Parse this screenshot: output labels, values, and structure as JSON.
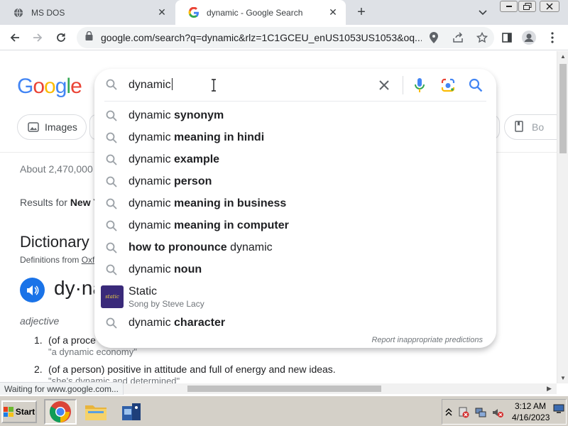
{
  "tabs": [
    {
      "title": "MS DOS",
      "active": false
    },
    {
      "title": "dynamic - Google Search",
      "active": true
    }
  ],
  "window_controls": {
    "minimize": "minimize",
    "restore": "restore",
    "close": "close"
  },
  "omnibox": {
    "url": "google.com/search?q=dynamic&rlz=1C1GCEU_enUS1053US1053&oq..."
  },
  "logo_letters": [
    "G",
    "o",
    "o",
    "g",
    "l",
    "e"
  ],
  "chips": {
    "images": "Images",
    "books": "Bo"
  },
  "results": {
    "about": "About 2,470,000",
    "results_for_prefix": "Results for ",
    "results_for_location": "New Y"
  },
  "dictionary": {
    "title": "Dictionary",
    "definitions_from": "Definitions from ",
    "definitions_source": "Oxf",
    "word": "dy·na",
    "part_of_speech": "adjective",
    "definitions": [
      {
        "num": "1.",
        "text": "(of a proce",
        "example": "\"a dynamic economy\""
      },
      {
        "num": "2.",
        "text": "(of a person) positive in attitude and full of energy and new ideas.",
        "example": "\"she's dynamic and determined\""
      }
    ]
  },
  "search": {
    "query": "dynamic",
    "suggestions": [
      {
        "normal": "dynamic ",
        "bold": "synonym",
        "bold_first": false
      },
      {
        "normal": "dynamic ",
        "bold": "meaning in hindi",
        "bold_first": false
      },
      {
        "normal": "dynamic ",
        "bold": "example",
        "bold_first": false
      },
      {
        "normal": "dynamic ",
        "bold": "person",
        "bold_first": false
      },
      {
        "normal": "dynamic ",
        "bold": "meaning in business",
        "bold_first": false
      },
      {
        "normal": "dynamic ",
        "bold": "meaning in computer",
        "bold_first": false
      },
      {
        "normal": " dynamic",
        "bold": "how to pronounce",
        "bold_first": true
      },
      {
        "normal": "dynamic ",
        "bold": "noun",
        "bold_first": false
      }
    ],
    "rich_suggestion": {
      "title": "Static",
      "subtitle": "Song by Steve Lacy",
      "thumb_text": "static"
    },
    "last_suggestion": {
      "normal": "dynamic ",
      "bold": "character"
    },
    "report": "Report inappropriate predictions"
  },
  "status_text": "Waiting for www.google.com...",
  "taskbar": {
    "start": "Start",
    "time": "3:12 AM",
    "date": "4/16/2023"
  },
  "colors": {
    "google_blue": "#4285f4",
    "accent_blue": "#1a73e8",
    "tabstrip": "#dee1e6",
    "taskbar": "#d4d0c8"
  }
}
